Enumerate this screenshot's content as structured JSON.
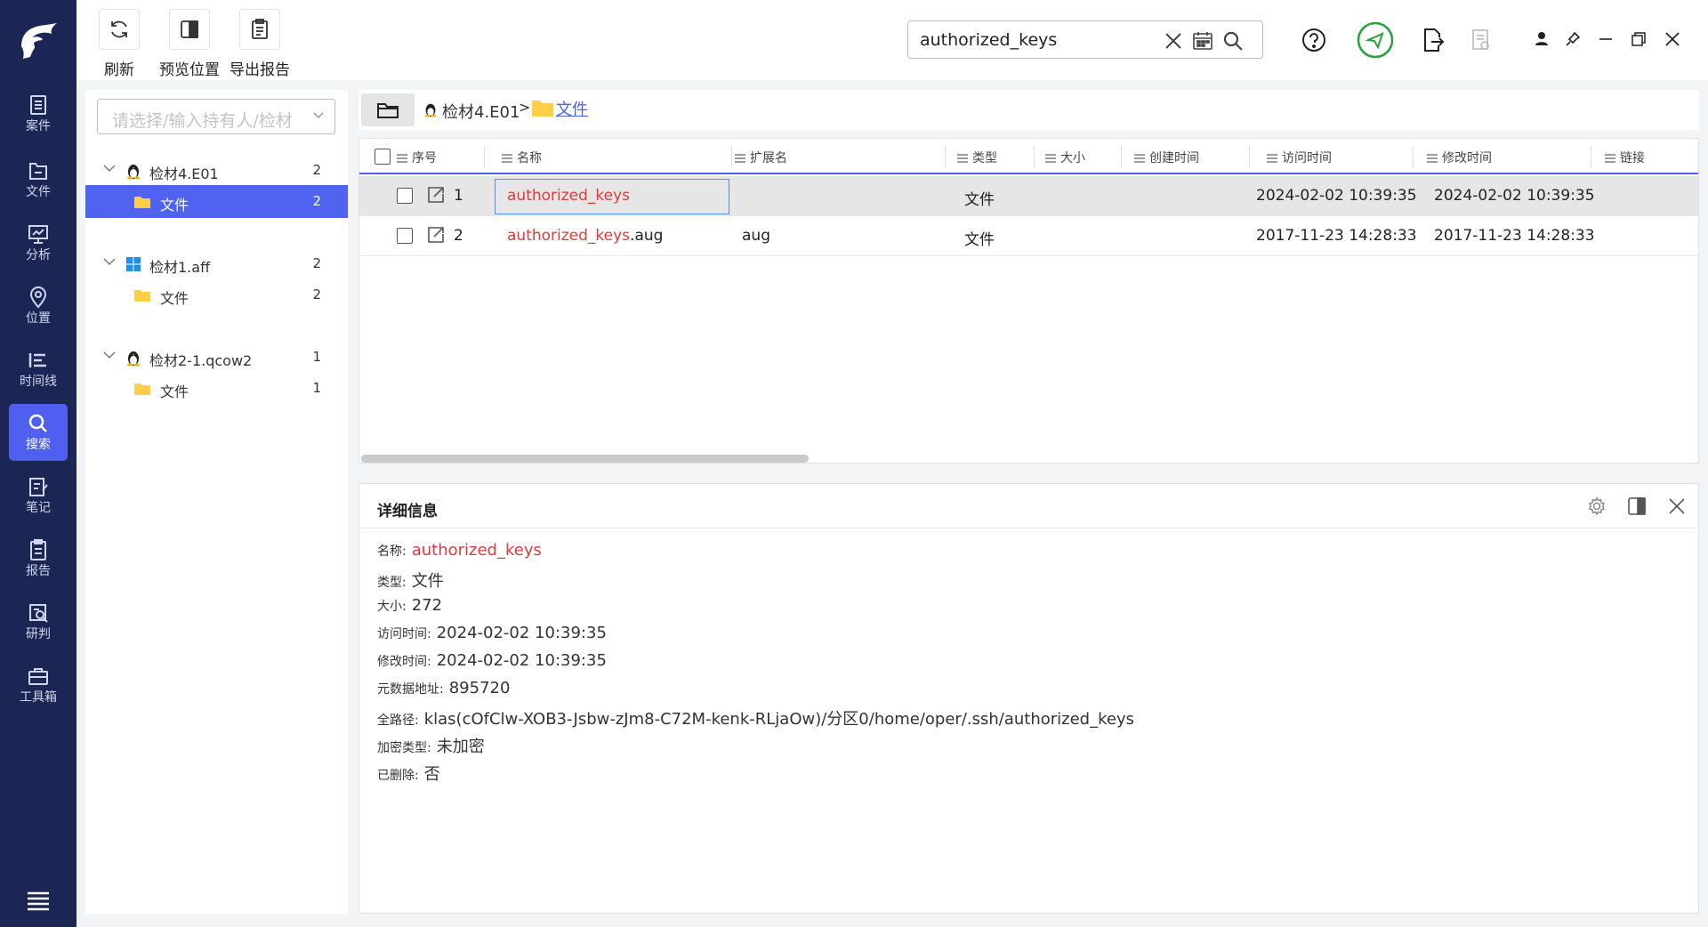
{
  "nav": {
    "items": [
      {
        "label": "案件"
      },
      {
        "label": "文件"
      },
      {
        "label": "分析"
      },
      {
        "label": "位置"
      },
      {
        "label": "时间线"
      },
      {
        "label": "搜索"
      },
      {
        "label": "笔记"
      },
      {
        "label": "报告"
      },
      {
        "label": "研判"
      },
      {
        "label": "工具箱"
      }
    ],
    "active": "搜索",
    "accent": "#4f5ff0",
    "bg": "#1b2654"
  },
  "toolbar": {
    "refresh_label": "刷新",
    "preview_label": "预览位置",
    "export_label": "导出报告"
  },
  "search": {
    "value": "authorized_keys"
  },
  "tree": {
    "placeholder": "请选择/输入持有人/检材",
    "nodes": [
      {
        "label": "检材4.E01",
        "count": "2",
        "os": "linux"
      },
      {
        "label": "文件",
        "count": "2"
      },
      {
        "label": "检材1.aff",
        "count": "2",
        "os": "windows"
      },
      {
        "label": "文件",
        "count": "2"
      },
      {
        "label": "检材2-1.qcow2",
        "count": "1",
        "os": "linux"
      },
      {
        "label": "文件",
        "count": "1"
      }
    ]
  },
  "breadcrumb": {
    "evidence": "检材4.E01",
    "sep": ">",
    "folder": "文件"
  },
  "table": {
    "columns": [
      "序号",
      "名称",
      "扩展名",
      "类型",
      "大小",
      "创建时间",
      "访问时间",
      "修改时间",
      "链接"
    ],
    "rows": [
      {
        "index": "1",
        "name_hit": "authorized_keys",
        "name_rest": "",
        "ext": "",
        "type": "文件",
        "size": "",
        "created": "",
        "accessed": "2024-02-02 10:39:35",
        "modified": "2024-02-02 10:39:35",
        "link": ""
      },
      {
        "index": "2",
        "name_hit": "authorized_keys",
        "name_rest": ".aug",
        "ext": "aug",
        "type": "文件",
        "size": "",
        "created": "",
        "accessed": "2017-11-23 14:28:33",
        "modified": "2017-11-23 14:28:33",
        "link": ""
      }
    ],
    "highlight_color": "#e23a3a"
  },
  "detail": {
    "title": "详细信息",
    "fields": [
      {
        "label": "名称:",
        "value": "authorized_keys"
      },
      {
        "label": "类型:",
        "value": "文件"
      },
      {
        "label": "大小:",
        "value": "272"
      },
      {
        "label": "访问时间:",
        "value": "2024-02-02 10:39:35"
      },
      {
        "label": "修改时间:",
        "value": "2024-02-02 10:39:35"
      },
      {
        "label": "元数据地址:",
        "value": "895720"
      },
      {
        "label": "全路径:",
        "value": "klas(cOfClw-XOB3-Jsbw-zJm8-C72M-kenk-RLjaOw)/分区0/home/oper/.ssh/authorized_keys"
      },
      {
        "label": "加密类型:",
        "value": "未加密"
      },
      {
        "label": "已删除:",
        "value": "否"
      }
    ]
  }
}
